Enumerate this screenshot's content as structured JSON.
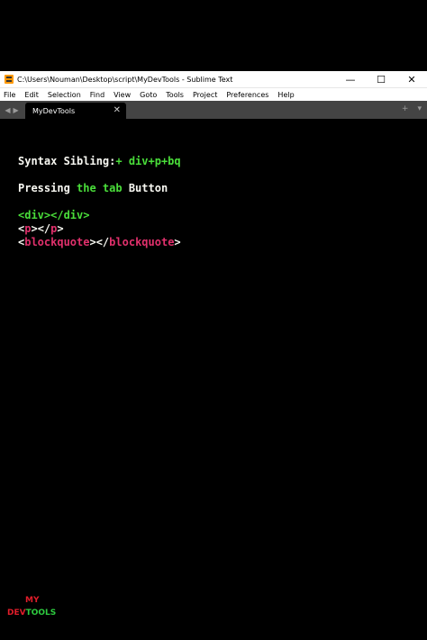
{
  "window": {
    "title": "C:\\Users\\Nouman\\Desktop\\script\\MyDevTools - Sublime Text",
    "controls": {
      "minimize": "—",
      "maximize": "☐",
      "close": "✕"
    }
  },
  "menu": [
    "File",
    "Edit",
    "Selection",
    "Find",
    "View",
    "Goto",
    "Tools",
    "Project",
    "Preferences",
    "Help"
  ],
  "tabs": {
    "nav_left": "◀",
    "nav_right": "▶",
    "active_tab": "MyDevTools",
    "close": "✕",
    "new_tab": "+",
    "dropdown": "▾"
  },
  "editor": {
    "line1": {
      "label": "Syntax Sibling:",
      "value": "+ div+p+bq"
    },
    "line2": {
      "before": "Pressing ",
      "highlight": "the tab",
      "after": " Button"
    },
    "line3": {
      "text": "<div></div>"
    },
    "line4": {
      "open_lt": "<",
      "open_tag": "p",
      "mid": "></",
      "close_tag": "p",
      "close_gt": ">"
    },
    "line5": {
      "open_lt": "<",
      "open_tag": "blockquote",
      "mid": "></",
      "close_tag": "blockquote",
      "close_gt": ">"
    }
  },
  "logo": {
    "top": "MY",
    "dev": "DEV",
    "tools": "TOOLS"
  },
  "colors": {
    "background": "#000000",
    "green": "#4ade3a",
    "pink": "#e1306c",
    "text": "#f8f8f2",
    "tabbar": "#444444"
  },
  "icons": {
    "app": "sublime-text-icon",
    "minimize": "minimize-icon",
    "maximize": "maximize-icon",
    "close": "close-icon"
  }
}
